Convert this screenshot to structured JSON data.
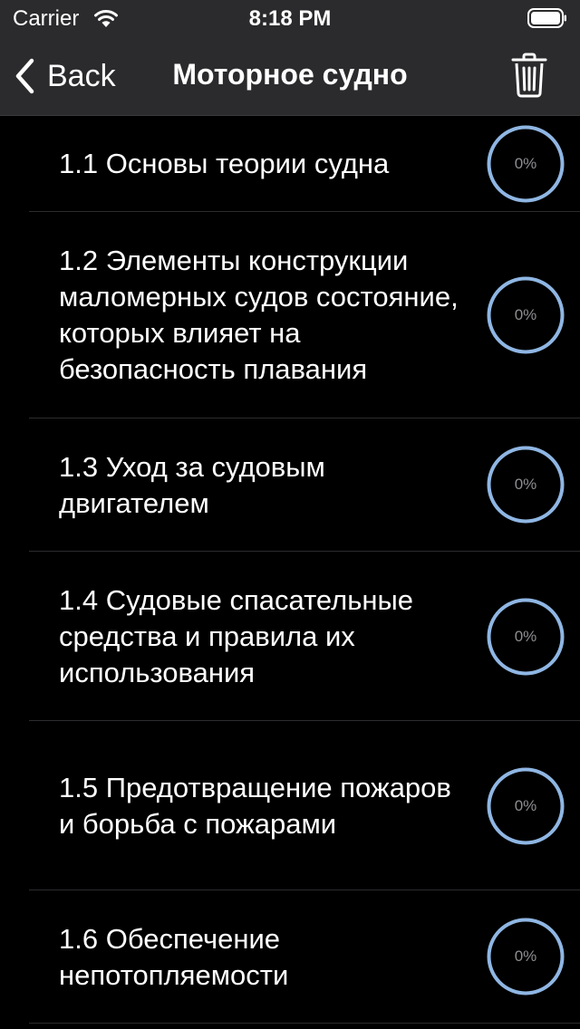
{
  "status_bar": {
    "carrier": "Carrier",
    "time": "8:18 PM"
  },
  "nav": {
    "back_label": "Back",
    "title": "Моторное судно"
  },
  "colors": {
    "progress_ring": "#8fb6e3",
    "background": "#000000",
    "nav_background": "#2b2b2d"
  },
  "topics": [
    {
      "label": "1.1 Основы теории судна",
      "progress": "0%"
    },
    {
      "label": "1.2 Элементы конструкции маломерных судов состояние, которых влияет на безопасность плавания",
      "progress": "0%"
    },
    {
      "label": "1.3 Уход за судовым двигателем",
      "progress": "0%"
    },
    {
      "label": "1.4 Судовые спасательные средства и правила их использования",
      "progress": "0%"
    },
    {
      "label": "1.5 Предотвращение пожаров и борьба с пожарами",
      "progress": "0%"
    },
    {
      "label": "1.6 Обеспечение непотопляемости",
      "progress": "0%"
    }
  ]
}
